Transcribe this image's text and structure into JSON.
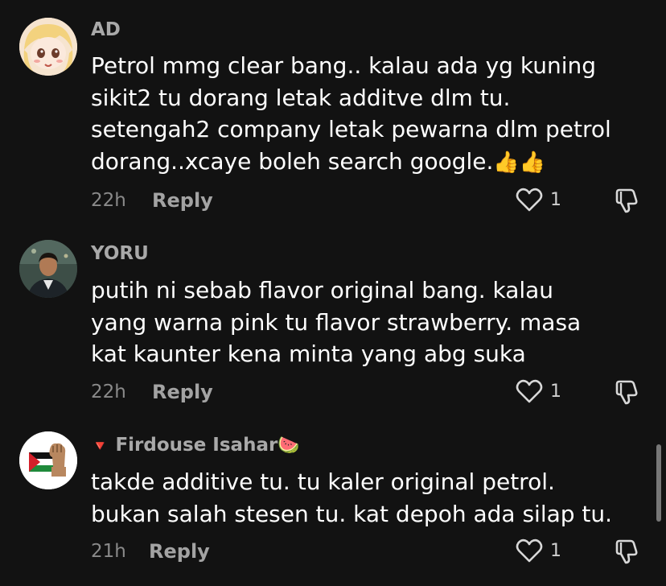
{
  "comments": [
    {
      "username": "AD",
      "text": "Petrol mmg clear bang.. kalau ada yg kuning sikit2 tu dorang letak additve dlm tu. setengah2 company letak pewarna dlm petrol dorang..xcaye boleh search google.",
      "emoji": "👍👍",
      "time": "22h",
      "reply": "Reply",
      "likes": "1",
      "avatar_icon": "anime-girl-avatar"
    },
    {
      "username": "YORU",
      "text": "putih ni sebab flavor original bang. kalau yang warna pink tu flavor strawberry. masa kat kaunter kena minta yang abg suka",
      "emoji": "",
      "time": "22h",
      "reply": "Reply",
      "likes": "1",
      "avatar_icon": "man-photo-avatar"
    },
    {
      "username": "Firdouse Isahar",
      "prefix_emoji": "🔻",
      "suffix_emoji": "🍉",
      "text": "takde additive tu. tu kaler original petrol. bukan salah stesen tu. kat depoh ada silap tu.",
      "emoji": "",
      "time": "21h",
      "reply": "Reply",
      "likes": "1",
      "avatar_icon": "palestine-flag-fist-avatar"
    }
  ],
  "colors": {
    "background": "#121212",
    "username": "#a9a9a9",
    "meta": "#8a8a8a",
    "text": "#ffffff"
  }
}
